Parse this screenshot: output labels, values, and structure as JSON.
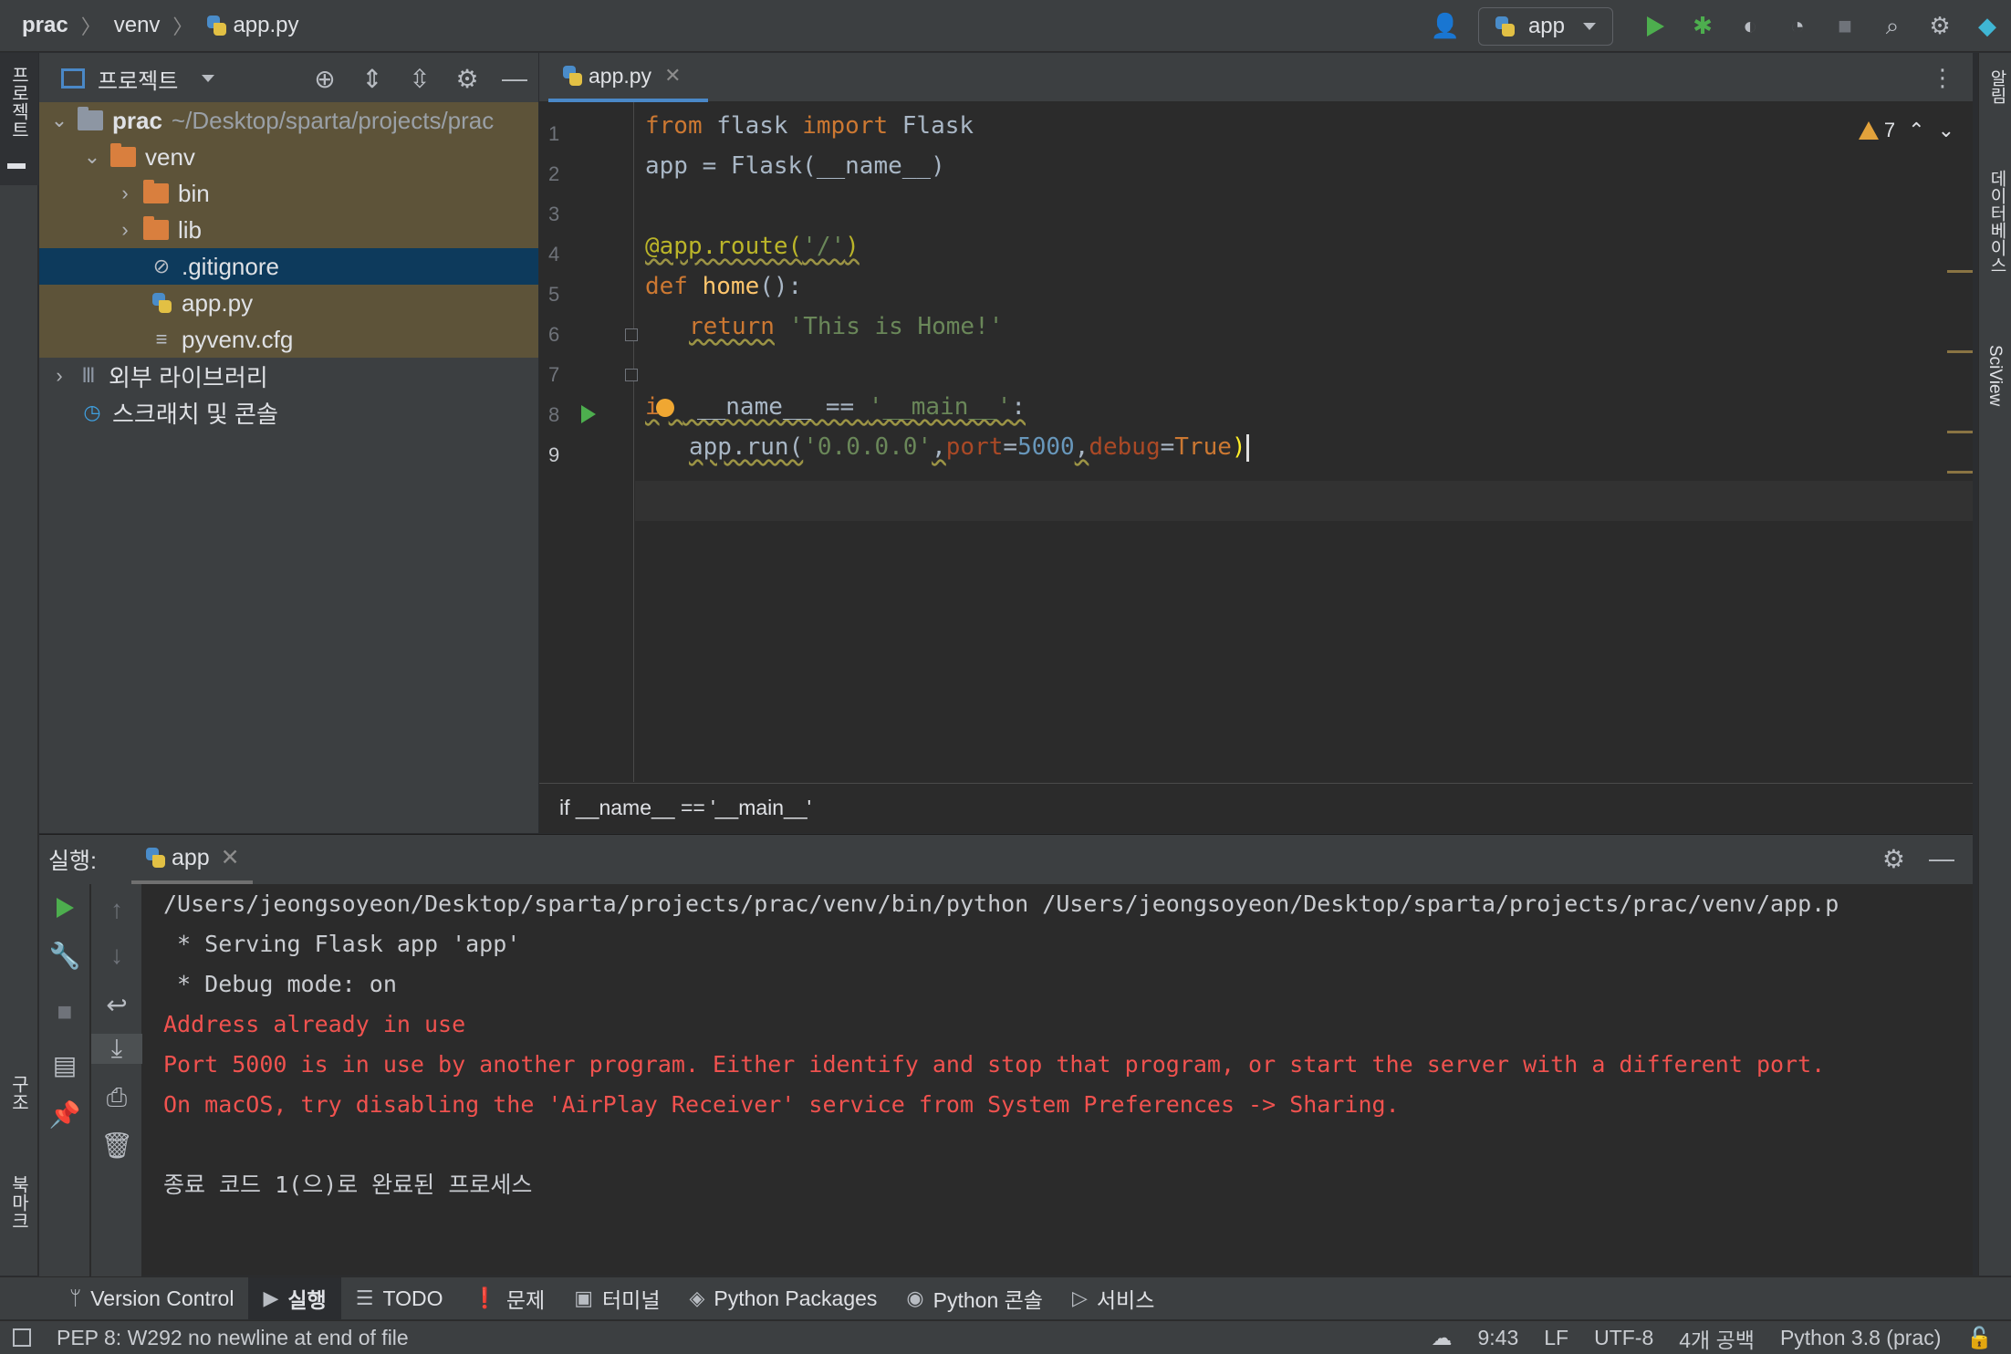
{
  "breadcrumb": [
    "prac",
    "venv",
    "app.py"
  ],
  "toolbar": {
    "run_config": "app"
  },
  "left_stripe": {
    "project_label": "프로젝트",
    "structure_label": "구조",
    "bookmarks_label": "북마크"
  },
  "right_stripe": {
    "notifications_label": "알림",
    "database_label": "데이터베이스",
    "sciview_label": "SciView"
  },
  "project_panel": {
    "title": "프로젝트",
    "tree": [
      {
        "name": "prac",
        "path": "~/Desktop/sparta/projects/prac"
      },
      {
        "name": "venv"
      },
      {
        "name": "bin"
      },
      {
        "name": "lib"
      },
      {
        "name": ".gitignore"
      },
      {
        "name": "app.py"
      },
      {
        "name": "pyvenv.cfg"
      },
      {
        "name": "외부 라이브러리"
      },
      {
        "name": "스크래치 및 콘솔"
      }
    ]
  },
  "editor": {
    "tab": "app.py",
    "warnings_count": "7",
    "line_numbers": [
      "1",
      "2",
      "3",
      "4",
      "5",
      "6",
      "7",
      "8",
      "9"
    ],
    "code": {
      "l1_kw1": "from",
      "l1_mod": " flask ",
      "l1_kw2": "import",
      "l1_cls": " Flask",
      "l2": "app = Flask(__name__)",
      "l4_dec": "@app.route(",
      "l4_str": "'/'",
      "l4_close": ")",
      "l5_kw": "def",
      "l5_fn": " home",
      "l5_rest": "():",
      "l6_kw": "return",
      "l6_str": " 'This is Home!'",
      "l8_a": "i",
      "l8_b": "f",
      "l8_c": " __name__ == ",
      "l8_str": "'__main__'",
      "l8_colon": ":",
      "l9_a": "app.run(",
      "l9_host": "'0.0.0.0'",
      "l9_c1": ",",
      "l9_p1": "port",
      "l9_eq1": "=",
      "l9_port": "5000",
      "l9_c2": ",",
      "l9_p2": "debug",
      "l9_eq2": "=",
      "l9_true": "True",
      "l9_close": ")"
    },
    "breadcrumb_bottom": "if __name__ == '__main__'"
  },
  "run_panel": {
    "label": "실행:",
    "tab": "app",
    "console": [
      {
        "text": "/Users/jeongsoyeon/Desktop/sparta/projects/prac/venv/bin/python /Users/jeongsoyeon/Desktop/sparta/projects/prac/venv/app.p",
        "type": "normal"
      },
      {
        "text": " * Serving Flask app 'app'",
        "type": "normal"
      },
      {
        "text": " * Debug mode: on",
        "type": "normal"
      },
      {
        "text": "Address already in use",
        "type": "err"
      },
      {
        "text": "Port 5000 is in use by another program. Either identify and stop that program, or start the server with a different port.",
        "type": "err"
      },
      {
        "text": "On macOS, try disabling the 'AirPlay Receiver' service from System Preferences -> Sharing.",
        "type": "err"
      },
      {
        "text": "",
        "type": "normal"
      },
      {
        "text": "종료 코드 1(으)로 완료된 프로세스",
        "type": "normal"
      }
    ]
  },
  "tool_tabs": [
    "Version Control",
    "실행",
    "TODO",
    "문제",
    "터미널",
    "Python Packages",
    "Python 콘솔",
    "서비스"
  ],
  "status_bar": {
    "message": "PEP 8: W292 no newline at end of file",
    "position": "9:43",
    "line_sep": "LF",
    "encoding": "UTF-8",
    "indent": "4개 공백",
    "interpreter": "Python 3.8 (prac)"
  }
}
